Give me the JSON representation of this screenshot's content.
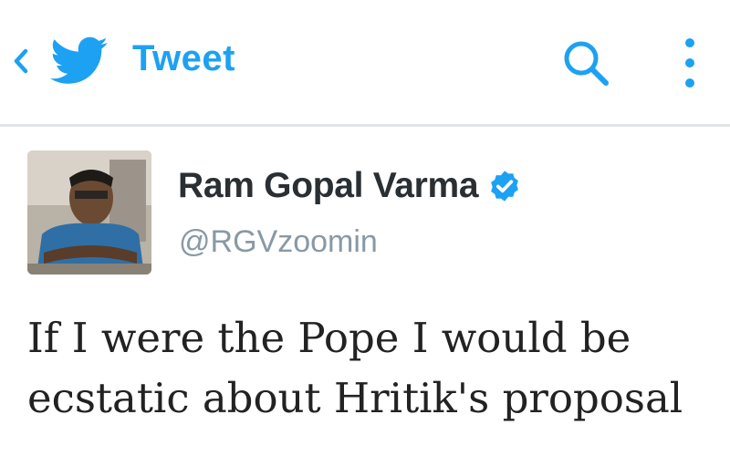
{
  "header": {
    "title": "Tweet",
    "back_icon": "chevron-left-icon",
    "logo_icon": "twitter-bird-icon",
    "search_icon": "search-icon",
    "more_icon": "more-vertical-icon",
    "accent_color": "#1da1f2"
  },
  "tweet": {
    "author_name": "Ram Gopal Varma",
    "verified": true,
    "handle": "@RGVzoomin",
    "text": "If I were the Pope I would be ecstatic about Hritik's proposal"
  }
}
